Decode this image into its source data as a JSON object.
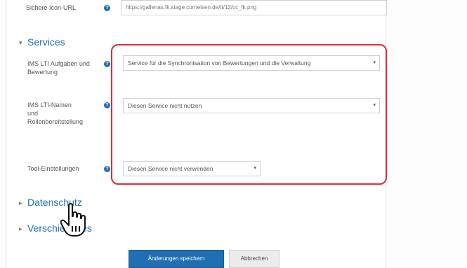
{
  "icon_url": {
    "label": "Sichere Icon-URL",
    "value": "https://gallenas.fk.stage.cornelsen.de/tt/12/cc_fk.png"
  },
  "services": {
    "title": "Services",
    "fields": [
      {
        "label": "IMS LTI Aufgaben und Bewertung",
        "value": "Service für die Synchronisation von Bewertungen und die Verwaltung"
      },
      {
        "label": "IMS LTI-Namen und Rollenbereitstellung",
        "value": "Diesen Service nicht nutzen"
      },
      {
        "label": "Tool-Einstellungen",
        "value": "Diesen Service nicht verwenden"
      }
    ]
  },
  "sections": {
    "privacy": "Datenschutz",
    "misc": "Verschiedenes"
  },
  "buttons": {
    "save": "Änderungen speichern",
    "cancel": "Abbrechen"
  },
  "colors": {
    "accent": "#1f6fb2",
    "highlight": "#e22b32"
  }
}
